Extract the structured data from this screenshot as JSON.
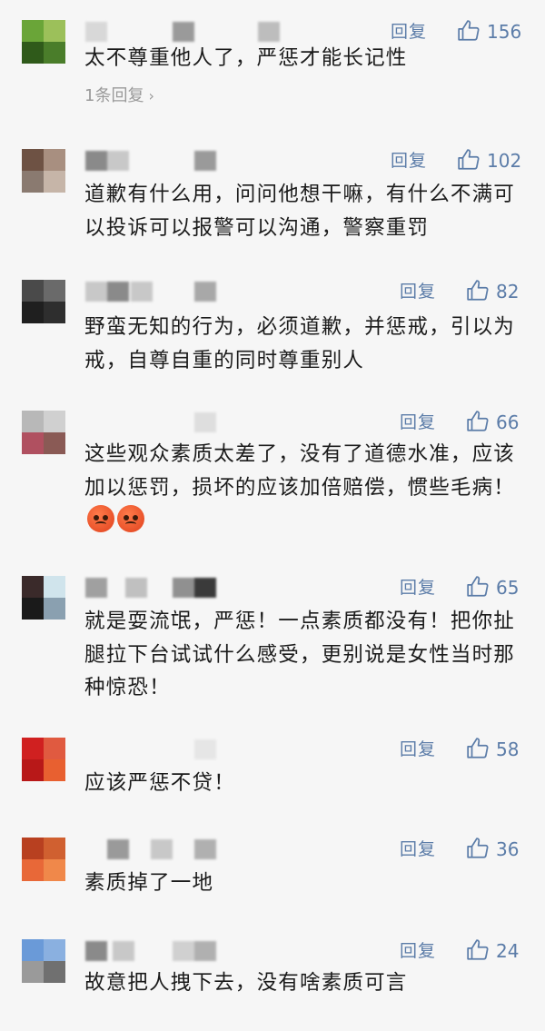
{
  "comments": [
    {
      "avatar": [
        "#6aa538",
        "#9cc05a",
        "#2f5a1a",
        "#4a7d2a"
      ],
      "name_blocks": [
        [
          "#d8d8d8",
          0
        ],
        [
          "#9a9a9a",
          96
        ],
        [
          "#bdbdbd",
          190
        ]
      ],
      "reply": "回复",
      "likes": "156",
      "text": "太不尊重他人了，严惩才能长记性",
      "sub_replies": "1条回复"
    },
    {
      "avatar": [
        "#6e5244",
        "#a88f80",
        "#8a7a70",
        "#c6b5a8"
      ],
      "name_blocks": [
        [
          "#8a8a8a",
          0
        ],
        [
          "#c8c8c8",
          24
        ],
        [
          "#9a9a9a",
          120
        ]
      ],
      "reply": "回复",
      "likes": "102",
      "text": "道歉有什么用，问问他想干嘛，有什么不满可以投诉可以报警可以沟通，警察重罚"
    },
    {
      "avatar": [
        "#4a4a4a",
        "#6a6a6a",
        "#1f1f1f",
        "#2e2e2e"
      ],
      "name_blocks": [
        [
          "#c8c8c8",
          0
        ],
        [
          "#8a8a8a",
          24
        ],
        [
          "#c8c8c8",
          50
        ],
        [
          "#a8a8a8",
          120
        ]
      ],
      "reply": "回复",
      "likes": "82",
      "text": "野蛮无知的行为，必须道歉，并惩戒，引以为戒，自尊自重的同时尊重别人"
    },
    {
      "avatar": [
        "#b8b8b8",
        "#d0d0d0",
        "#b05060",
        "#8a5a55"
      ],
      "name_blocks": [
        [
          "#dedede",
          120
        ]
      ],
      "reply": "回复",
      "likes": "66",
      "text": "这些观众素质太差了，没有了道德水准，应该加以惩罚，损坏的应该加倍赔偿，惯些毛病！",
      "emoji": [
        "angry-face-icon",
        "angry-face-icon"
      ]
    },
    {
      "avatar": [
        "#3a2a2a",
        "#d0e4ec",
        "#1a1a1a",
        "#8aa0b0"
      ],
      "name_blocks": [
        [
          "#a0a0a0",
          0
        ],
        [
          "#c0c0c0",
          44
        ],
        [
          "#909090",
          96
        ],
        [
          "#3a3a3a",
          120
        ]
      ],
      "reply": "回复",
      "likes": "65",
      "text": "就是耍流氓，严惩！一点素质都没有！把你扯腿拉下台试试什么感受，更别说是女性当时那种惊恐！"
    },
    {
      "avatar": [
        "#d02020",
        "#e05a40",
        "#b81818",
        "#e86030"
      ],
      "name_blocks": [
        [
          "#e6e6e6",
          120
        ]
      ],
      "reply": "回复",
      "likes": "58",
      "text": "应该严惩不贷！"
    },
    {
      "avatar": [
        "#b84020",
        "#d06030",
        "#e86838",
        "#f0884a"
      ],
      "name_blocks": [
        [
          "#9a9a9a",
          24
        ],
        [
          "#c8c8c8",
          72
        ],
        [
          "#b0b0b0",
          120
        ]
      ],
      "reply": "回复",
      "likes": "36",
      "text": "素质掉了一地"
    },
    {
      "avatar": [
        "#6a9ad8",
        "#8ab0e0",
        "#9a9a9a",
        "#707070"
      ],
      "name_blocks": [
        [
          "#8a8a8a",
          0
        ],
        [
          "#c8c8c8",
          30
        ],
        [
          "#d0d0d0",
          96
        ],
        [
          "#b0b0b0",
          120
        ]
      ],
      "reply": "回复",
      "likes": "24",
      "text": "故意把人拽下去，没有啥素质可言"
    }
  ]
}
